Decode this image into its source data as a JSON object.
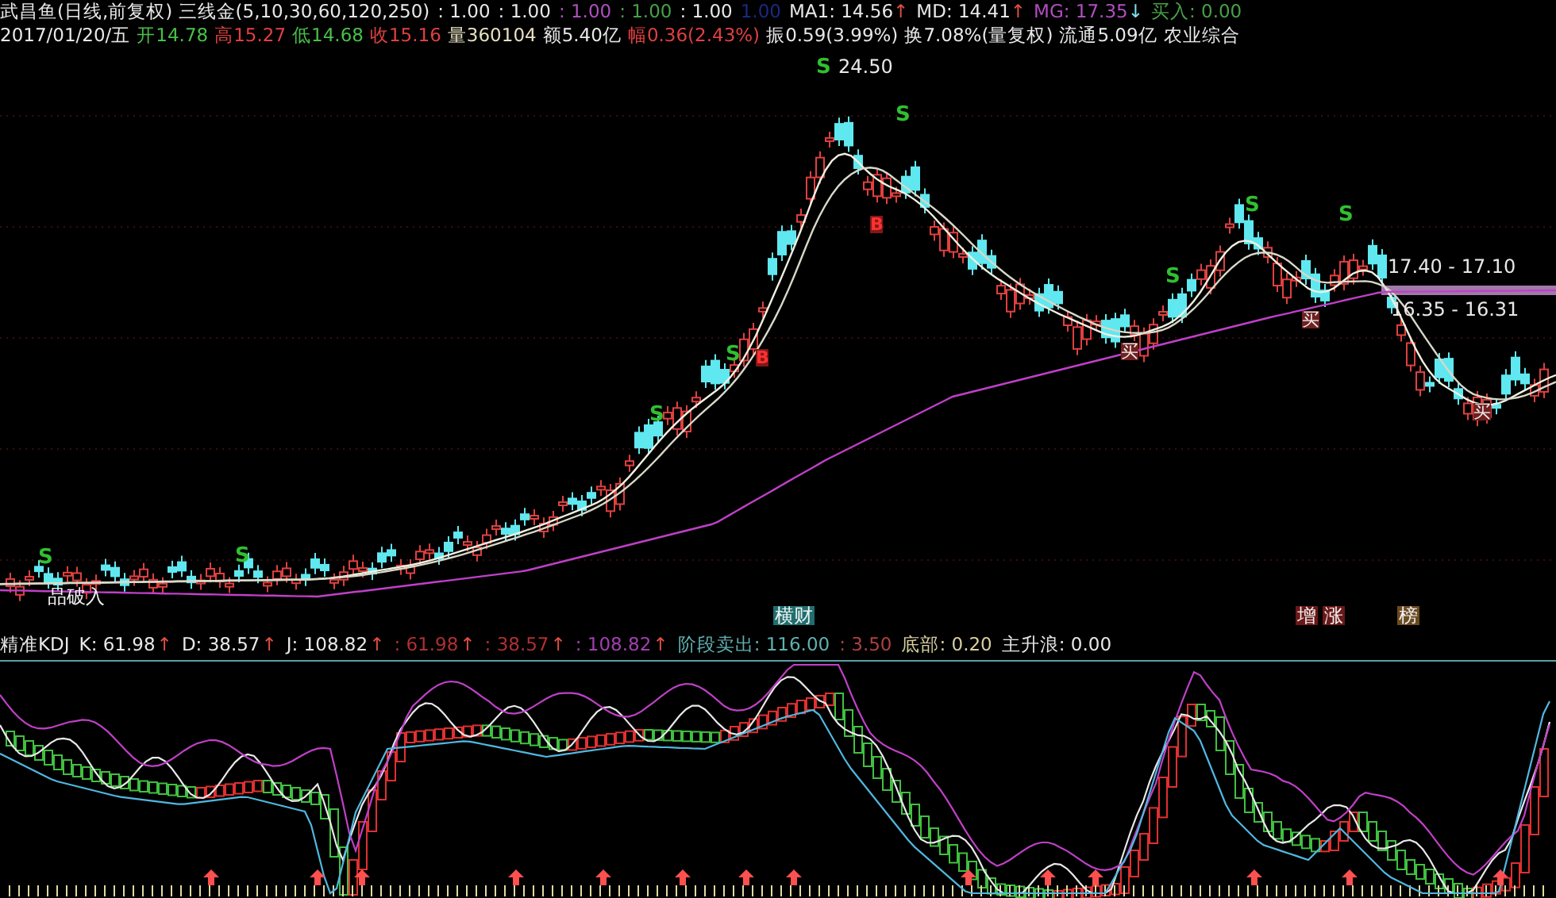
{
  "header": {
    "line1": [
      {
        "text": "武昌鱼(日线,前复权) 三线金(5,10,30,60,120,250)",
        "color": "#e8e8e8"
      },
      {
        "text": ": 1.00",
        "color": "#e8e8e8"
      },
      {
        "text": ": 1.00",
        "color": "#e8e8e8"
      },
      {
        "text": ": 1.00",
        "color": "#b04fc0"
      },
      {
        "text": ": 1.00",
        "color": "#48a048"
      },
      {
        "text": ": 1.00",
        "color": "#e8e8e8"
      },
      {
        "text": "1.00",
        "color": "#1a2a80"
      },
      {
        "text": "MA1: 14.56",
        "color": "#e8e8e8"
      },
      {
        "text": "↑",
        "color": "#e05040"
      },
      {
        "text": "MD: 14.41",
        "color": "#e8e8e8"
      },
      {
        "text": "↑",
        "color": "#e05040"
      },
      {
        "text": "MG: 17.35",
        "color": "#b04fc0"
      },
      {
        "text": "↓",
        "color": "#80e0f0"
      },
      {
        "text": "买入: 0.00",
        "color": "#48a048"
      }
    ],
    "line2": [
      {
        "text": "2017/01/20/五",
        "color": "#e8e8e8"
      },
      {
        "text": "开14.78",
        "color": "#48c048"
      },
      {
        "text": "高15.27",
        "color": "#e04040"
      },
      {
        "text": "低14.68",
        "color": "#48c048"
      },
      {
        "text": "收15.16",
        "color": "#e04040"
      },
      {
        "text": "量360104",
        "color": "#e8e0c0"
      },
      {
        "text": "额5.40亿",
        "color": "#e8e8e8"
      },
      {
        "text": "幅0.36(2.43%)",
        "color": "#e04040"
      },
      {
        "text": "振0.59(3.99%)",
        "color": "#e8e8e8"
      },
      {
        "text": "换7.08%(量复权)",
        "color": "#e8e8e8"
      },
      {
        "text": "流通5.09亿",
        "color": "#e8e8e8"
      },
      {
        "text": "农业综合",
        "color": "#e8e8e8"
      }
    ]
  },
  "main_chart": {
    "price_labels": [
      "24.50",
      "17.40 - 17.10",
      "16.35 - 16.31"
    ],
    "signals": [
      {
        "text": "S",
        "kind": "sell"
      },
      {
        "text": "S",
        "kind": "sell"
      },
      {
        "text": "S",
        "kind": "sell"
      },
      {
        "text": "S",
        "kind": "sell"
      },
      {
        "text": "S",
        "kind": "sell"
      },
      {
        "text": "S",
        "kind": "sell"
      },
      {
        "text": "S",
        "kind": "sell"
      },
      {
        "text": "S",
        "kind": "sell"
      },
      {
        "text": "S",
        "kind": "sell"
      },
      {
        "text": "B",
        "kind": "buy"
      },
      {
        "text": "B",
        "kind": "buy"
      },
      {
        "text": "买",
        "kind": "buy_tag"
      },
      {
        "text": "买",
        "kind": "buy_tag"
      },
      {
        "text": "买",
        "kind": "buy_tag"
      }
    ],
    "note": "品破入",
    "tags": [
      {
        "text": "横财",
        "color": "#1f6f6f"
      },
      {
        "text": "增",
        "color": "#6a1818"
      },
      {
        "text": "涨",
        "color": "#6a1818"
      },
      {
        "text": "榜",
        "color": "#6a4a20"
      }
    ]
  },
  "indicator": {
    "items": [
      {
        "text": "精准KDJ",
        "color": "#e8e8e8"
      },
      {
        "text": "K: 61.98",
        "color": "#e8e8e8"
      },
      {
        "text": "↑",
        "color": "#e05040"
      },
      {
        "text": "D: 38.57",
        "color": "#e8e8e8"
      },
      {
        "text": "↑",
        "color": "#e05040"
      },
      {
        "text": "J: 108.82",
        "color": "#e8e8e8"
      },
      {
        "text": "↑",
        "color": "#e05040"
      },
      {
        "text": ": 61.98",
        "color": "#b03030"
      },
      {
        "text": "↑",
        "color": "#e05040"
      },
      {
        "text": ": 38.57",
        "color": "#b03030"
      },
      {
        "text": "↑",
        "color": "#e05040"
      },
      {
        "text": ": 108.82",
        "color": "#a040b0"
      },
      {
        "text": "↑",
        "color": "#e05040"
      },
      {
        "text": "阶段卖出: 116.00",
        "color": "#60b0b0"
      },
      {
        "text": ": 3.50",
        "color": "#b04040"
      },
      {
        "text": "底部: 0.20",
        "color": "#d8d0a0"
      },
      {
        "text": "主升浪: 0.00",
        "color": "#e8e8e8"
      }
    ]
  }
}
